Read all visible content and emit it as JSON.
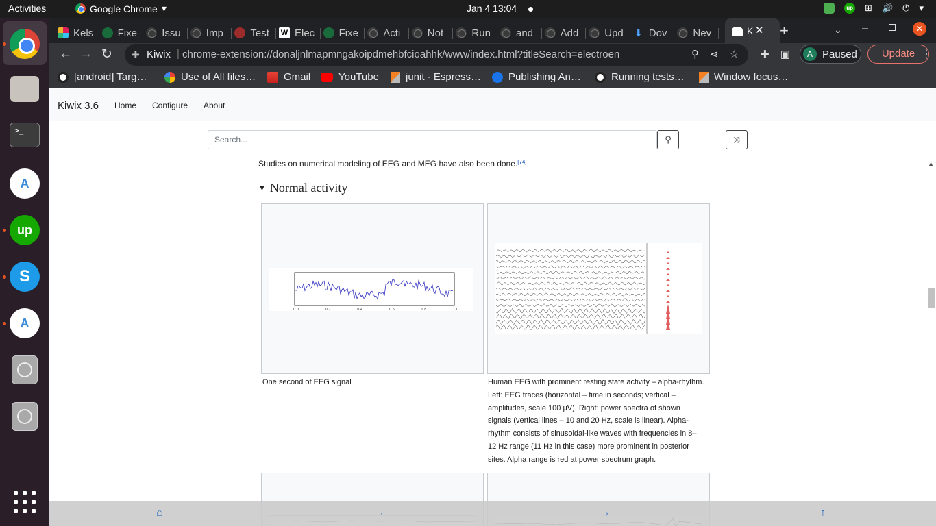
{
  "topbar": {
    "activities": "Activities",
    "app_name": "Google Chrome",
    "clock": "Jan 4  13:04",
    "tray_up_label": "up"
  },
  "dock": {
    "terminal_label": ">_",
    "upwork_label": "up",
    "skype_label": "S",
    "android_label": "A"
  },
  "tabs": [
    {
      "label": "Kels",
      "icon": "slack-icon"
    },
    {
      "label": "Fixe",
      "icon": "check-icon"
    },
    {
      "label": "Issu",
      "icon": "github-icon"
    },
    {
      "label": "Imp",
      "icon": "github-icon"
    },
    {
      "label": "Test",
      "icon": "check-icon"
    },
    {
      "label": "Elec",
      "icon": "wikipedia-icon"
    },
    {
      "label": "Fixe",
      "icon": "check-icon"
    },
    {
      "label": "Acti",
      "icon": "github-icon"
    },
    {
      "label": "Not",
      "icon": "github-icon"
    },
    {
      "label": "Run",
      "icon": "github-icon"
    },
    {
      "label": "and",
      "icon": "github-icon"
    },
    {
      "label": "Add",
      "icon": "github-icon"
    },
    {
      "label": "Upd",
      "icon": "github-icon"
    },
    {
      "label": "Dov",
      "icon": "download-icon"
    },
    {
      "label": "Nev",
      "icon": "github-icon"
    }
  ],
  "active_tab": {
    "label": "K",
    "close": "✕"
  },
  "toolbar": {
    "site_name": "Kiwix",
    "url": "chrome-extension://donaljnlmapmngakoipdmehbfcioahhk/www/index.html?titleSearch=electroen",
    "profile_initial": "A",
    "profile_status": "Paused",
    "update_label": "Update"
  },
  "bookmarks": [
    {
      "label": "[android] Targ…",
      "icon": "github-icon"
    },
    {
      "label": "Use of All files…",
      "icon": "google-icon"
    },
    {
      "label": "Gmail",
      "icon": "gmail-icon"
    },
    {
      "label": "YouTube",
      "icon": "youtube-icon"
    },
    {
      "label": "junit - Espress…",
      "icon": "stackoverflow-icon"
    },
    {
      "label": "Publishing An…",
      "icon": "publish-icon"
    },
    {
      "label": "Running tests…",
      "icon": "github-icon"
    },
    {
      "label": "Window focus…",
      "icon": "stackoverflow-icon"
    }
  ],
  "kiwix": {
    "brand": "Kiwix 3.6",
    "nav": [
      "Home",
      "Configure",
      "About"
    ],
    "search_placeholder": "Search..."
  },
  "article": {
    "paragraph": "Studies on numerical modeling of EEG and MEG have also been done.",
    "citation": "[74]",
    "section_title": "Normal activity",
    "fig1_caption": "One second of EEG signal",
    "fig1_ticks": [
      "0.0",
      "0.2",
      "0.4",
      "0.6",
      "0.8",
      "1.0"
    ],
    "fig2_caption": "Human EEG with prominent resting state activity – alpha-rhythm. Left: EEG traces (horizontal – time in seconds; vertical – amplitudes, scale 100 μV). Right: power spectra of shown signals (vertical lines – 10 and 20 Hz, scale is linear). Alpha-rhythm consists of sinusoidal-like waves with frequencies in 8–12 Hz range (11 Hz in this case) more prominent in posterior sites. Alpha range is red at power spectrum graph."
  },
  "colors": {
    "accent_link": "#0645ad",
    "update_red": "#f28b82",
    "ubuntu_orange": "#e95420",
    "eeg_trace": "#3030c0",
    "spectrum_red": "#e06060"
  }
}
